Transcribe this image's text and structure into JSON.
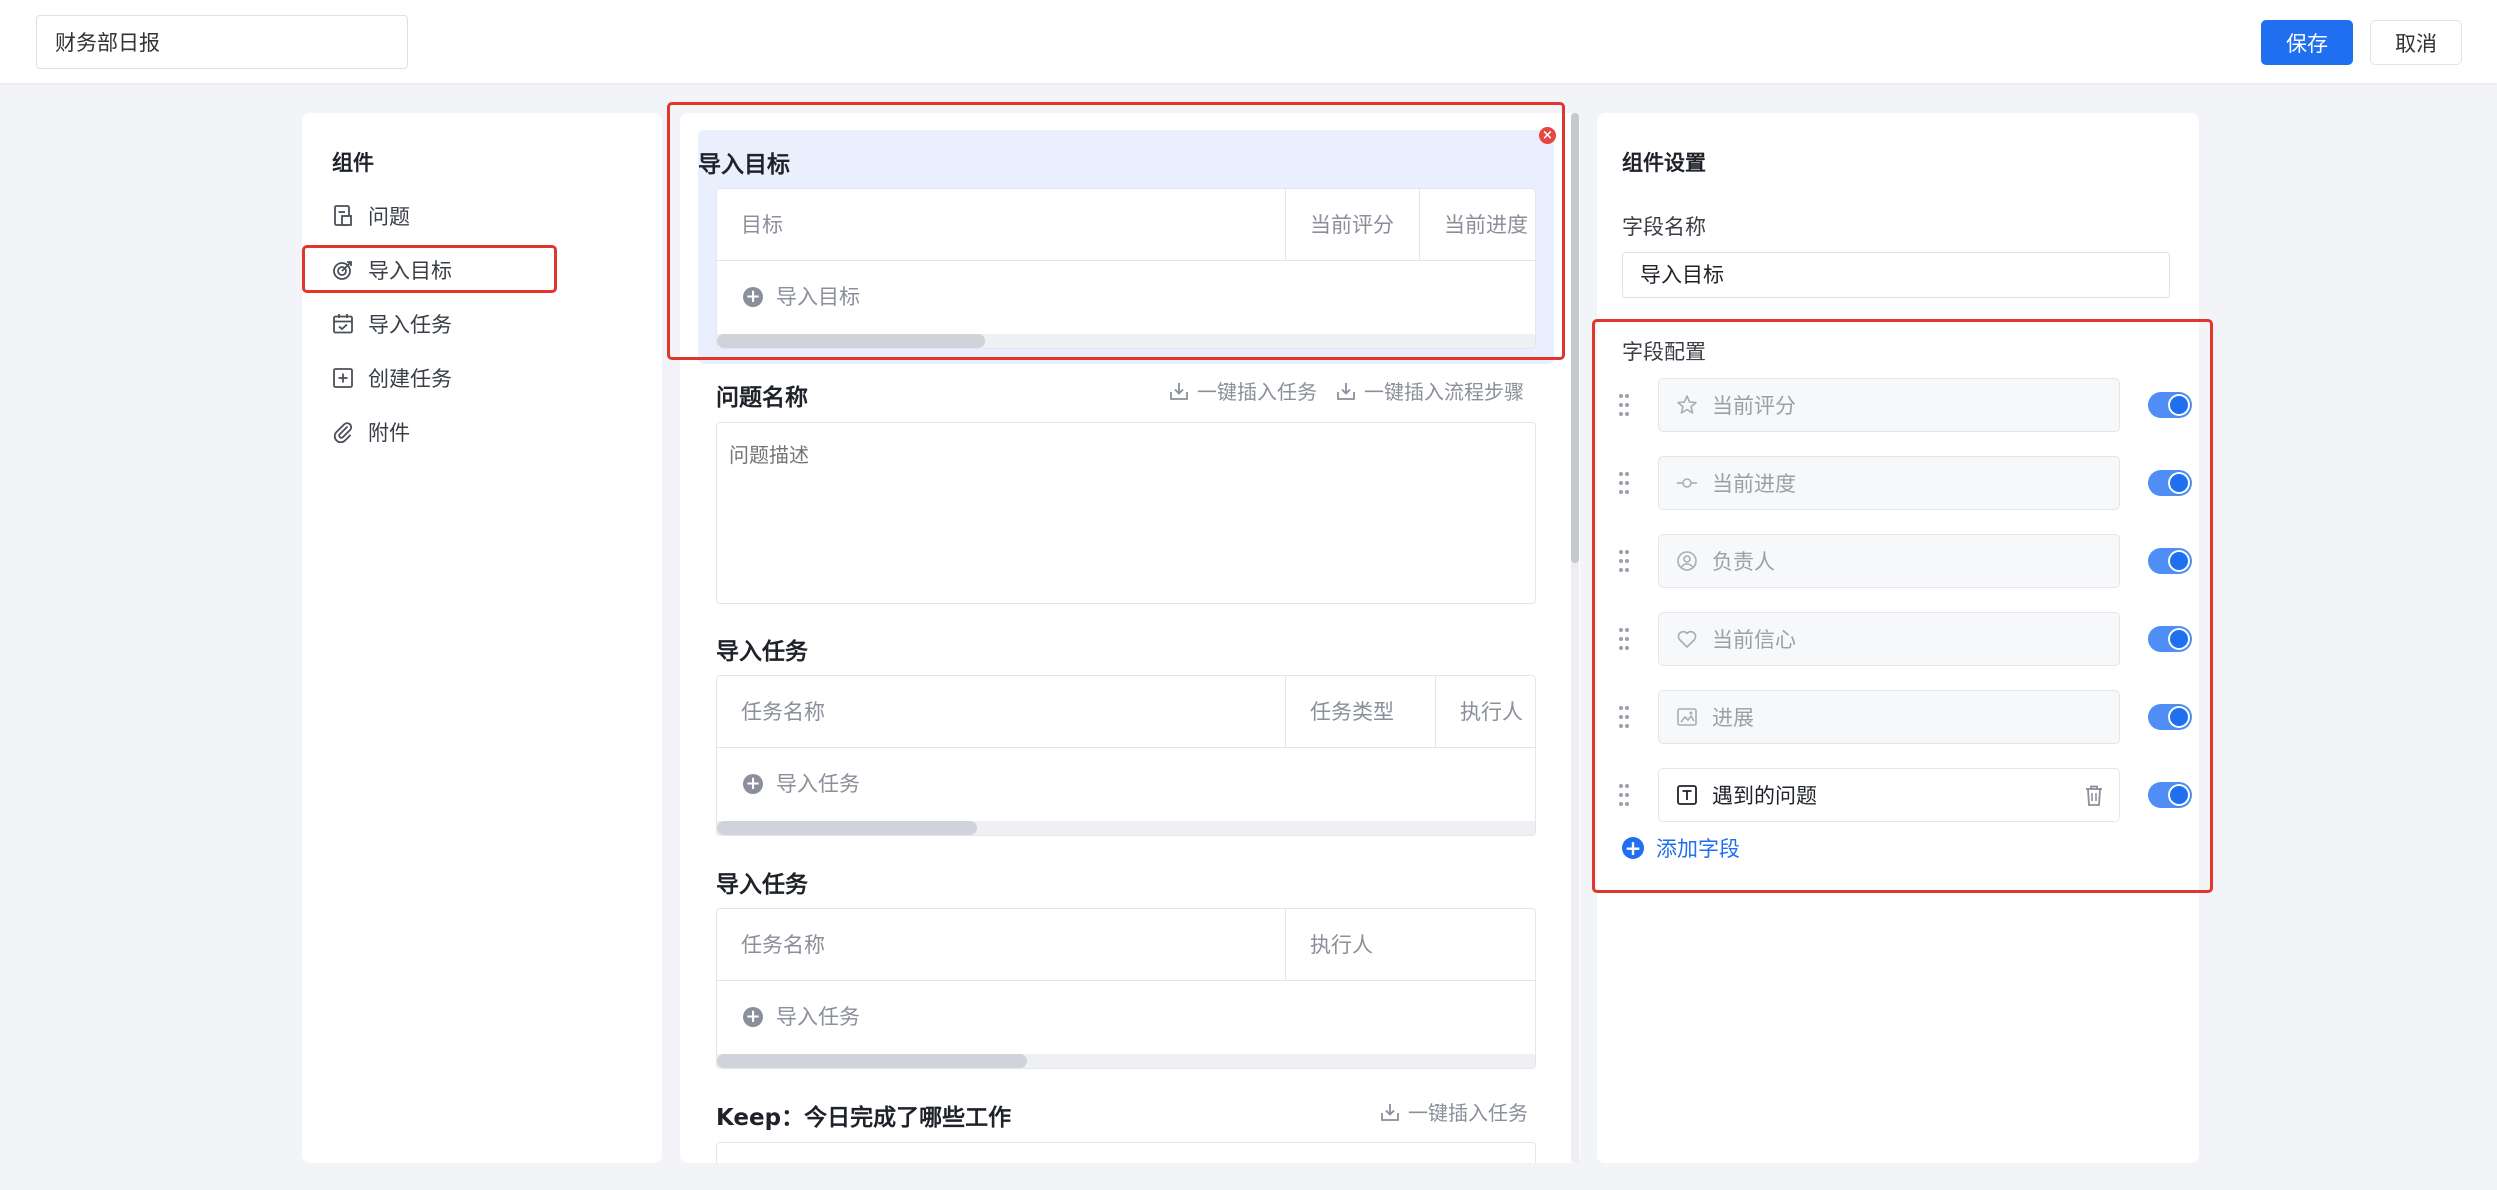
{
  "header": {
    "title_value": "财务部日报",
    "save_label": "保存",
    "cancel_label": "取消"
  },
  "components": {
    "title": "组件",
    "items": [
      {
        "label": "问题",
        "icon": "document-icon"
      },
      {
        "label": "导入目标",
        "icon": "target-icon"
      },
      {
        "label": "导入任务",
        "icon": "calendar-check-icon"
      },
      {
        "label": "创建任务",
        "icon": "plus-square-icon"
      },
      {
        "label": "附件",
        "icon": "paperclip-icon"
      }
    ]
  },
  "canvas": {
    "goal_block": {
      "title": "导入目标",
      "columns": [
        "目标",
        "当前评分",
        "当前进度"
      ],
      "add_label": "导入目标"
    },
    "problem_block": {
      "title": "问题名称",
      "quick_insert_task": "一键插入任务",
      "quick_insert_steps": "一键插入流程步骤",
      "placeholder": "问题描述"
    },
    "task_block_1": {
      "title": "导入任务",
      "columns": [
        "任务名称",
        "任务类型",
        "执行人"
      ],
      "add_label": "导入任务"
    },
    "task_block_2": {
      "title": "导入任务",
      "columns": [
        "任务名称",
        "执行人"
      ],
      "add_label": "导入任务"
    },
    "keep_block": {
      "title": "Keep：今日完成了哪些工作",
      "quick_insert_task": "一键插入任务"
    }
  },
  "settings": {
    "title": "组件设置",
    "field_name_label": "字段名称",
    "field_name_value": "导入目标",
    "field_config_label": "字段配置",
    "fields": [
      {
        "label": "当前评分",
        "icon": "star-icon",
        "enabled": true
      },
      {
        "label": "当前进度",
        "icon": "progress-icon",
        "enabled": true
      },
      {
        "label": "负责人",
        "icon": "user-circle-icon",
        "enabled": true
      },
      {
        "label": "当前信心",
        "icon": "heart-icon",
        "enabled": true
      },
      {
        "label": "进展",
        "icon": "image-icon",
        "enabled": true
      },
      {
        "label": "遇到的问题",
        "icon": "text-icon",
        "enabled": true
      }
    ],
    "add_field_label": "添加字段"
  },
  "colors": {
    "accent": "#1f6ff0",
    "highlight_border": "#e0362c",
    "selected_block_bg": "#e9effd"
  }
}
